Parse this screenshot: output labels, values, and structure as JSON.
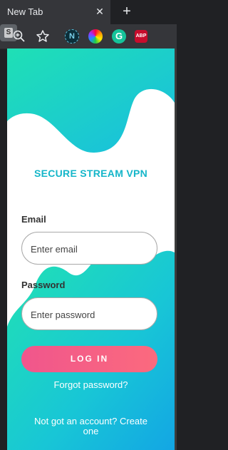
{
  "browser": {
    "tab_title": "New Tab",
    "tab_close": "✕",
    "new_tab": "+",
    "extensions": {
      "n_label": "N",
      "g_label": "G",
      "abp_label": "ABP",
      "s_label": "S"
    }
  },
  "app": {
    "title": "SECURE STREAM VPN",
    "email_label": "Email",
    "email_placeholder": "Enter email",
    "password_label": "Password",
    "password_placeholder": "Enter password",
    "login_button": "LOG IN",
    "forgot_link": "Forgot password?",
    "signup_link": "Not got an account? Create one"
  },
  "colors": {
    "accent": "#15b6c9",
    "teal": "#1fe0b5",
    "cyan": "#19bde0",
    "button": "#f0568c"
  }
}
